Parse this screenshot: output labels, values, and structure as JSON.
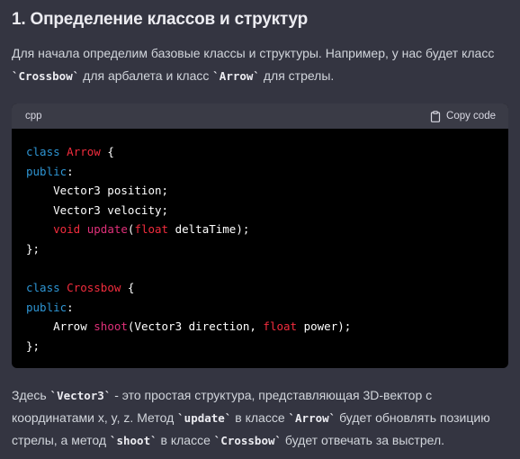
{
  "heading": "1. Определение классов и структур",
  "intro": {
    "text_1": "Для начала определим базовые классы и структуры. Например, у нас будет класс ",
    "code_1": "`Crossbow`",
    "text_2": " для арбалета и класс ",
    "code_2": "`Arrow`",
    "text_3": " для стрелы."
  },
  "code_block": {
    "language": "cpp",
    "copy_label": "Copy code",
    "lines": {
      "l1": {
        "kw": "class",
        "sp": " ",
        "name": "Arrow",
        "rest": " {"
      },
      "l2": {
        "kw": "public",
        "rest": ":"
      },
      "l3": {
        "text": "    Vector3 position;"
      },
      "l4": {
        "text": "    Vector3 velocity;"
      },
      "l5": {
        "indent": "    ",
        "kw": "void",
        "sp": " ",
        "fn": "update",
        "p1": "(",
        "ty": "float",
        "rest": " deltaTime);"
      },
      "l6": {
        "text": "};"
      },
      "l8": {
        "kw": "class",
        "sp": " ",
        "name": "Crossbow",
        "rest": " {"
      },
      "l9": {
        "kw": "public",
        "rest": ":"
      },
      "l10": {
        "pre": "    Arrow ",
        "fn": "shoot",
        "mid": "(Vector3 direction, ",
        "ty": "float",
        "rest": " power);"
      },
      "l11": {
        "text": "};"
      }
    }
  },
  "outro": {
    "t1": "Здесь ",
    "c1": "`Vector3`",
    "t2": " - это простая структура, представляющая 3D-вектор с координатами x, y, z. Метод ",
    "c2": "`update`",
    "t3": " в классе ",
    "c3": "`Arrow`",
    "t4": " будет обновлять позицию стрелы, а метод ",
    "c4": "`shoot`",
    "t5": " в классе ",
    "c5": "`Crossbow`",
    "t6": " будет отвечать за выстрел."
  },
  "colors": {
    "background": "#343541",
    "code_background": "#000000",
    "keyword": "#2e95d3",
    "class_name": "#f22c3d",
    "function_name": "#df3079"
  },
  "icons": {
    "copy": "clipboard-icon"
  }
}
